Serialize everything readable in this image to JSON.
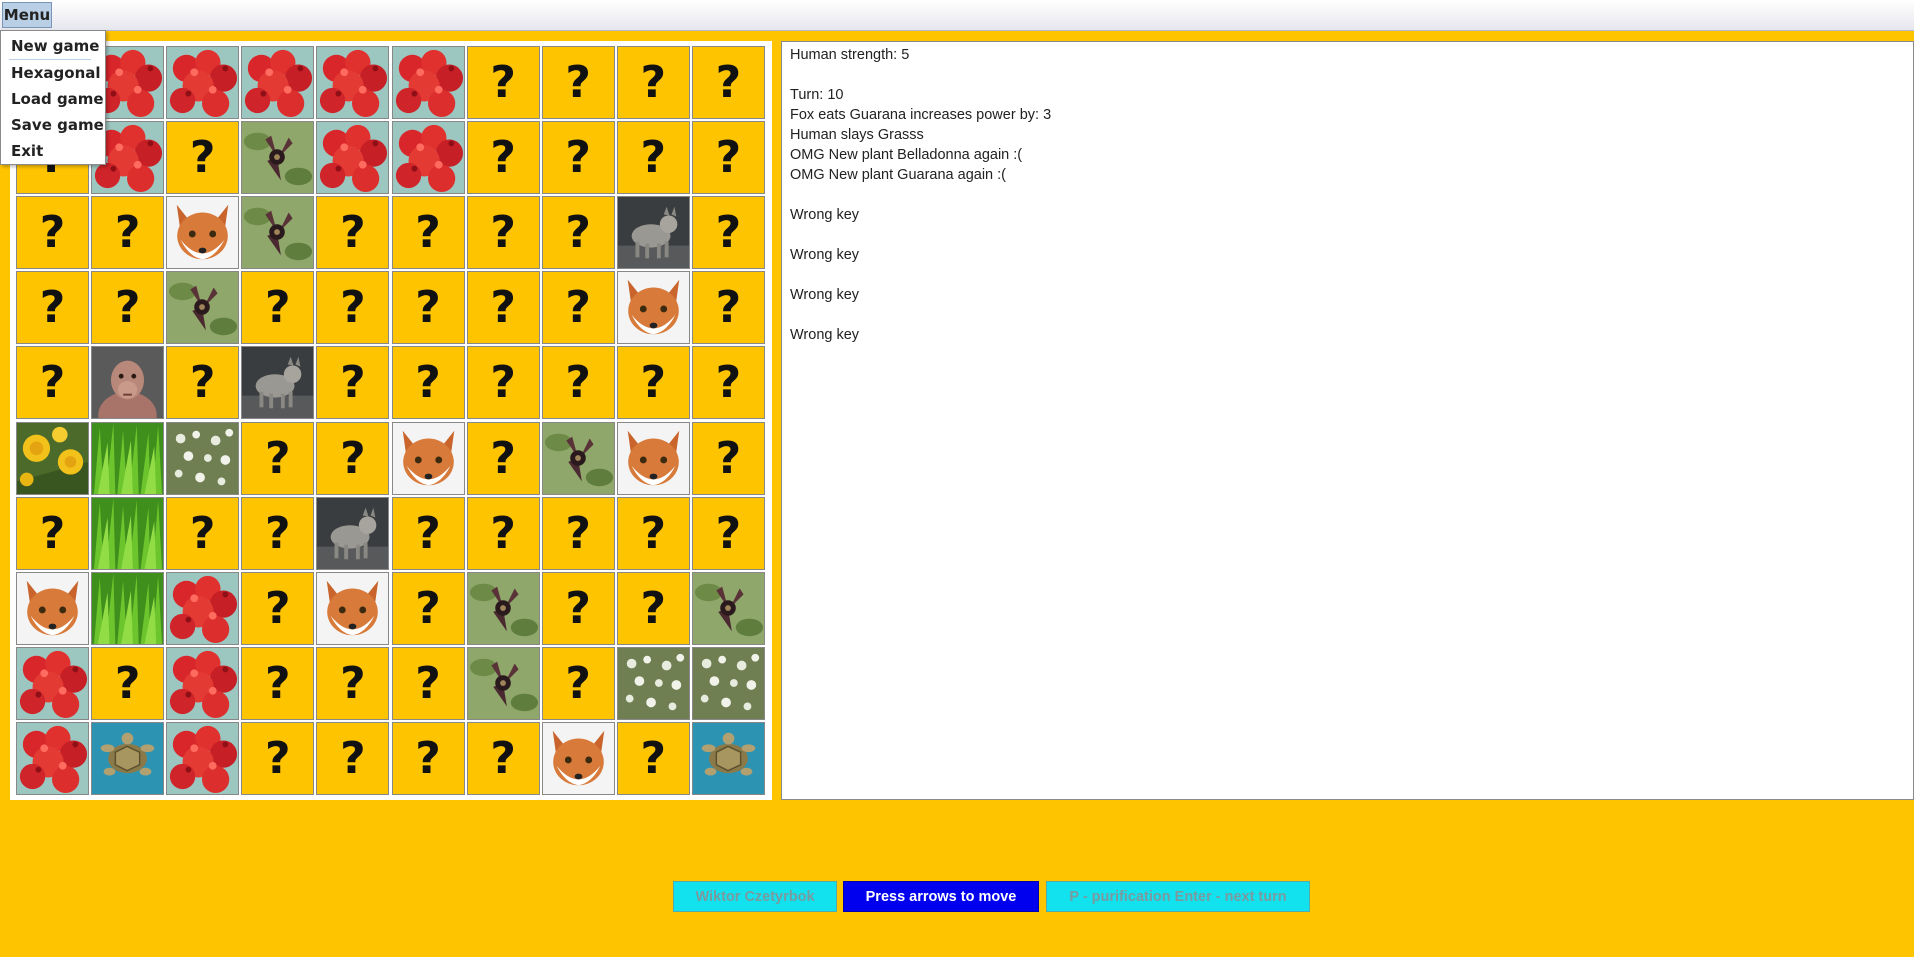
{
  "menubar": {
    "menu_label": "Menu"
  },
  "menu_items": [
    "New game",
    "Hexagonal",
    "Load game",
    "Save game",
    "Exit"
  ],
  "board": {
    "columns": 10,
    "rows": 10,
    "unknown_symbol": "?",
    "cells": [
      [
        "unknown",
        "sosnowsky",
        "sosnowsky",
        "sosnowsky",
        "sosnowsky",
        "sosnowsky",
        "unknown",
        "unknown",
        "unknown",
        "unknown"
      ],
      [
        "unknown",
        "sosnowsky",
        "unknown",
        "belladonna",
        "sosnowsky",
        "sosnowsky",
        "unknown",
        "unknown",
        "unknown",
        "unknown"
      ],
      [
        "unknown",
        "unknown",
        "fox",
        "belladonna",
        "unknown",
        "unknown",
        "unknown",
        "unknown",
        "wolf",
        "unknown"
      ],
      [
        "unknown",
        "unknown",
        "belladonna",
        "unknown",
        "unknown",
        "unknown",
        "unknown",
        "unknown",
        "fox",
        "unknown"
      ],
      [
        "unknown",
        "human",
        "unknown",
        "wolf",
        "unknown",
        "unknown",
        "unknown",
        "unknown",
        "unknown",
        "unknown"
      ],
      [
        "dandelion",
        "grass",
        "guarana",
        "unknown",
        "unknown",
        "fox",
        "unknown",
        "belladonna",
        "fox",
        "unknown"
      ],
      [
        "unknown",
        "grass",
        "unknown",
        "unknown",
        "wolf",
        "unknown",
        "unknown",
        "unknown",
        "unknown",
        "unknown"
      ],
      [
        "fox",
        "grass",
        "sosnowsky",
        "unknown",
        "fox",
        "unknown",
        "belladonna",
        "unknown",
        "unknown",
        "belladonna"
      ],
      [
        "sosnowsky",
        "unknown",
        "sosnowsky",
        "unknown",
        "unknown",
        "unknown",
        "belladonna",
        "unknown",
        "guarana",
        "guarana"
      ],
      [
        "sosnowsky",
        "turtle",
        "sosnowsky",
        "unknown",
        "unknown",
        "unknown",
        "unknown",
        "fox",
        "unknown",
        "turtle"
      ]
    ]
  },
  "log": {
    "lines": [
      "Human strength: 5",
      "",
      "Turn: 10",
      "Fox eats Guarana  increases power by: 3",
      "Human slays Grasss",
      "OMG New plant Belladonna again :(",
      "OMG New plant Guarana again :(",
      "",
      "Wrong key",
      "",
      "Wrong key",
      "",
      "Wrong key",
      "",
      "Wrong key"
    ]
  },
  "buttons": {
    "author": "Wiktor Czetyrbok",
    "arrows": "Press arrows to move",
    "keys": "P - purification Enter - next turn"
  },
  "colors": {
    "background": "#FFC400",
    "author_button": "#11E2EE",
    "arrows_button": "#0000EE",
    "keys_button": "#11E2EE"
  }
}
